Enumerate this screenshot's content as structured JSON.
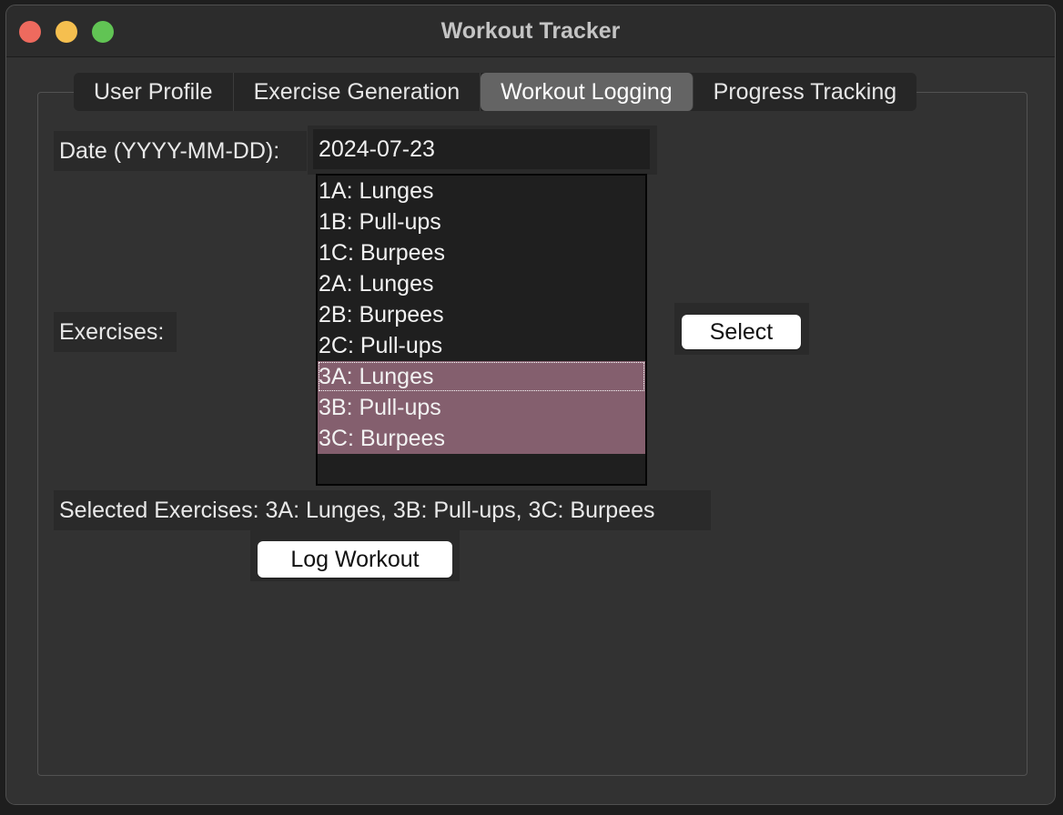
{
  "window": {
    "title": "Workout Tracker"
  },
  "tabs": [
    {
      "label": "User Profile"
    },
    {
      "label": "Exercise Generation"
    },
    {
      "label": "Workout Logging"
    },
    {
      "label": "Progress Tracking"
    }
  ],
  "active_tab": "Workout Logging",
  "form": {
    "date_label": "Date (YYYY-MM-DD):",
    "date_value": "2024-07-23",
    "exercises_label": "Exercises:",
    "exercise_options": [
      {
        "text": "1A: Lunges",
        "selected": false
      },
      {
        "text": "1B: Pull-ups",
        "selected": false
      },
      {
        "text": "1C: Burpees",
        "selected": false
      },
      {
        "text": "2A: Lunges",
        "selected": false
      },
      {
        "text": "2B: Burpees",
        "selected": false
      },
      {
        "text": "2C: Pull-ups",
        "selected": false
      },
      {
        "text": "3A: Lunges",
        "selected": true
      },
      {
        "text": "3B: Pull-ups",
        "selected": true
      },
      {
        "text": "3C: Burpees",
        "selected": true
      }
    ],
    "select_button": "Select",
    "selected_summary": "Selected Exercises: 3A: Lunges, 3B: Pull-ups, 3C: Burpees",
    "log_button": "Log Workout"
  },
  "colors": {
    "selection": "#845f6e",
    "close": "#ee6a5e",
    "minimize": "#f5bf4f",
    "maximize": "#61c454"
  }
}
